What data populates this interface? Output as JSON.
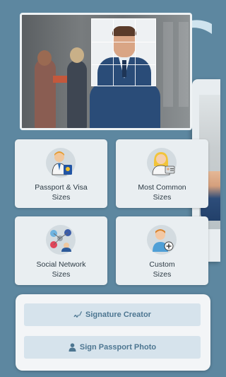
{
  "tiles": [
    {
      "label_line1": "Passport & Visa",
      "label_line2": "Sizes",
      "icon": "passport-officer-icon"
    },
    {
      "label_line1": "Most Common",
      "label_line2": "Sizes",
      "icon": "id-card-woman-icon"
    },
    {
      "label_line1": "Social Network",
      "label_line2": "Sizes",
      "icon": "social-network-icon"
    },
    {
      "label_line1": "Custom",
      "label_line2": "Sizes",
      "icon": "custom-size-person-icon"
    }
  ],
  "actions": {
    "signature_label": "Signature Creator",
    "signature_icon": "signature-pen-icon",
    "sign_photo_label": "Sign Passport Photo",
    "sign_photo_icon": "user-icon"
  },
  "colors": {
    "background": "#5d87a0",
    "tile": "#e9eef1",
    "action_button": "#d6e3ec",
    "action_text": "#4d7691"
  }
}
